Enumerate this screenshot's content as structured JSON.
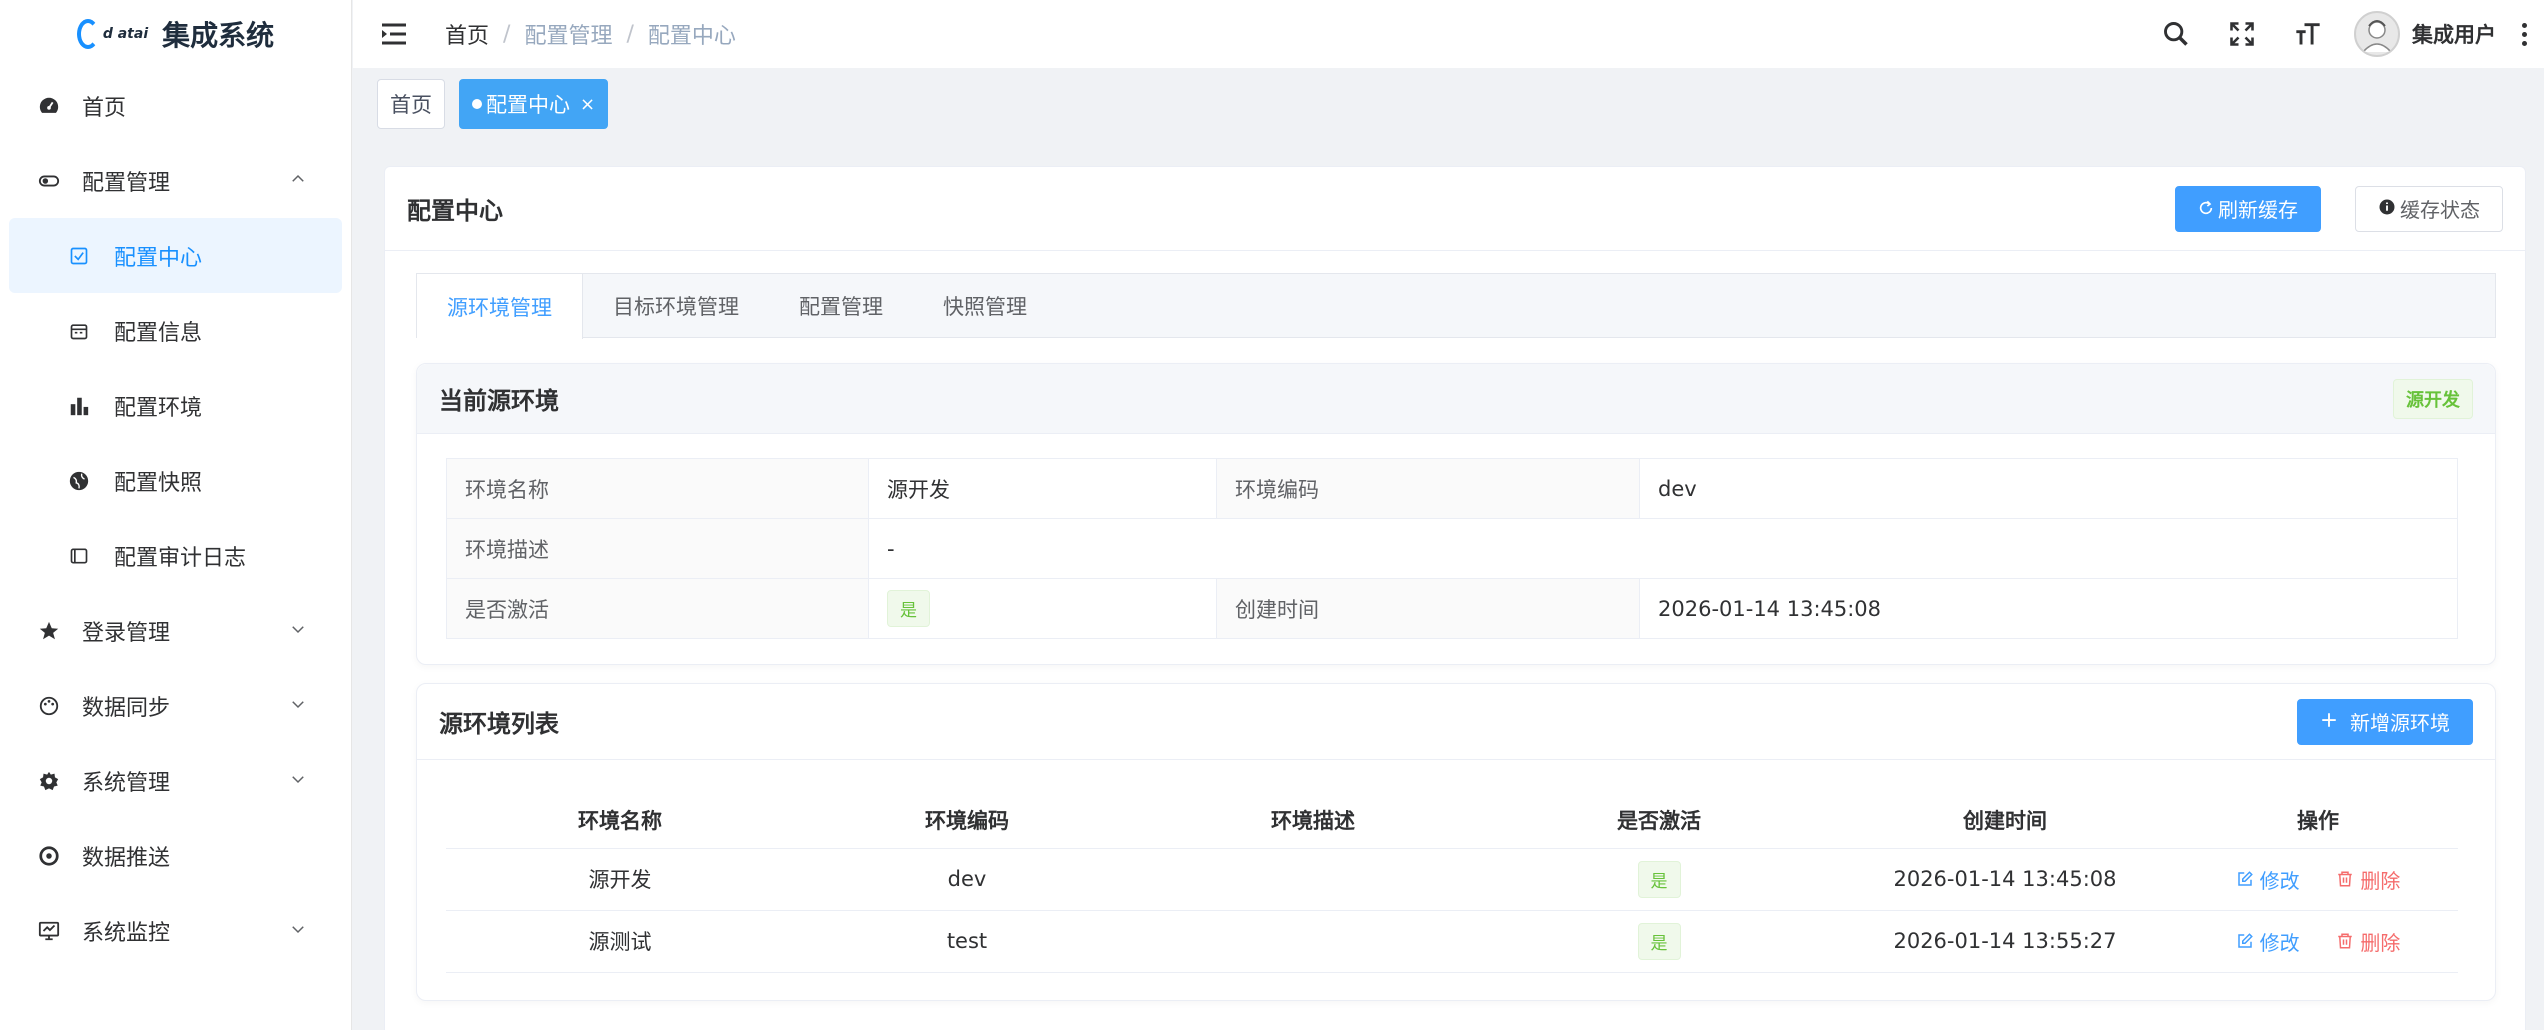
{
  "app": {
    "logo_text": "d atai",
    "title": "集成系统"
  },
  "sidebar": {
    "items": [
      {
        "label": "首页"
      },
      {
        "label": "配置管理",
        "children": [
          {
            "label": "配置中心"
          },
          {
            "label": "配置信息"
          },
          {
            "label": "配置环境"
          },
          {
            "label": "配置快照"
          },
          {
            "label": "配置审计日志"
          }
        ]
      },
      {
        "label": "登录管理"
      },
      {
        "label": "数据同步"
      },
      {
        "label": "系统管理"
      },
      {
        "label": "数据推送"
      },
      {
        "label": "系统监控"
      }
    ]
  },
  "header": {
    "breadcrumb": [
      "首页",
      "配置管理",
      "配置中心"
    ],
    "separator": "/",
    "username": "集成用户"
  },
  "tags": {
    "home": "首页",
    "current": "配置中心",
    "close": "×"
  },
  "card": {
    "title": "配置中心",
    "refresh_button": "刷新缓存",
    "status_button": "缓存状态"
  },
  "tabs": [
    "源环境管理",
    "目标环境管理",
    "配置管理",
    "快照管理"
  ],
  "current_env": {
    "title": "当前源环境",
    "badge": "源开发",
    "labels": {
      "name": "环境名称",
      "code": "环境编码",
      "desc": "环境描述",
      "active": "是否激活",
      "created": "创建时间"
    },
    "values": {
      "name": "源开发",
      "code": "dev",
      "desc": "-",
      "active": "是",
      "created": "2026-01-14 13:45:08"
    }
  },
  "env_list": {
    "title": "源环境列表",
    "add_button": "新增源环境",
    "columns": [
      "环境名称",
      "环境编码",
      "环境描述",
      "是否激活",
      "创建时间",
      "操作"
    ],
    "rows": [
      {
        "name": "源开发",
        "code": "dev",
        "desc": "",
        "active": "是",
        "created": "2026-01-14 13:45:08"
      },
      {
        "name": "源测试",
        "code": "test",
        "desc": "",
        "active": "是",
        "created": "2026-01-14 13:55:27"
      }
    ],
    "edit_label": "修改",
    "delete_label": "删除"
  },
  "colors": {
    "primary": "#409eff",
    "success": "#67c23a",
    "danger": "#f56c6c"
  }
}
